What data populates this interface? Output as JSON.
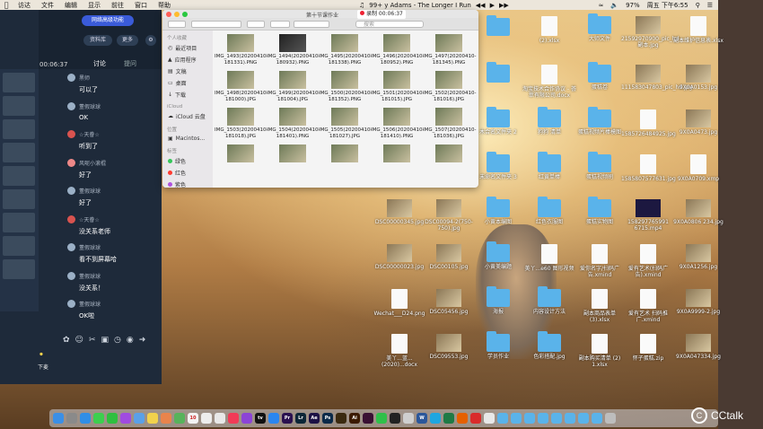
{
  "menubar": {
    "apple": "",
    "items": [
      "访达",
      "文件",
      "编辑",
      "显示",
      "前往",
      "窗口",
      "帮助"
    ],
    "now_playing": "99+ y Adams - The Longer I Run",
    "battery": "97%",
    "clock": "周五 下午6:55"
  },
  "recording": {
    "label": "录制 00:06:37"
  },
  "chat": {
    "promo": "网络高级功能",
    "buttons": {
      "materials": "资料库",
      "more": "更多"
    },
    "timer": "00:06:37",
    "tabs": [
      "讨论",
      "提问"
    ],
    "messages": [
      {
        "name": "黑师",
        "text": "可以了"
      },
      {
        "name": "董假球球",
        "text": "OK"
      },
      {
        "name": "☆天眷☆",
        "text": "听到了"
      },
      {
        "name": "风呢小滚棍",
        "text": "好了"
      },
      {
        "name": "董假球球",
        "text": "好了"
      },
      {
        "name": "☆天眷☆",
        "text": "没关系老师"
      },
      {
        "name": "董假球球",
        "text": "看不到屏幕哈"
      },
      {
        "name": "董假球球",
        "text": "没关系！"
      },
      {
        "name": "董假球球",
        "text": "OK啦"
      }
    ],
    "raise_hand": "下麦",
    "toolbar_icons": [
      "flower-icon",
      "emoji-icon",
      "scissors-icon",
      "image-icon",
      "clock-icon",
      "mic-icon",
      "send-icon"
    ]
  },
  "finder": {
    "title": "第十节课作业",
    "search_placeholder": "搜索",
    "sidebar": {
      "favorites_label": "个人收藏",
      "favorites": [
        "最近项目",
        "应用程序",
        "文稿",
        "桌面",
        "下载"
      ],
      "icloud_label": "iCloud",
      "icloud": [
        "iCloud 云盘"
      ],
      "locations_label": "位置",
      "locations": [
        "Macintos..."
      ],
      "tags_label": "标签",
      "tags": [
        {
          "name": "绿色",
          "color": "#34c759"
        },
        {
          "name": "红色",
          "color": "#ff3b30"
        },
        {
          "name": "紫色",
          "color": "#af52de"
        }
      ]
    },
    "files": [
      "IMG_1493(20200410-181331).PNG",
      "IMG_1494(20200410-180932).PNG",
      "IMG_1495(20200410-181338).PNG",
      "IMG_1496(20200410-180952).PNG",
      "IMG_1497(20200410-181345).PNG",
      "IMG_1498(20200410-181000).JPG",
      "IMG_1499(20200410-181004).JPG",
      "IMG_1500(20200410-181352).PNG",
      "IMG_1501(20200410-181015).JPG",
      "IMG_1502(20200410-181016).JPG",
      "IMG_1503(20200410-181018).JPG",
      "IMG_1504(20200410-181401).PNG",
      "IMG_1505(20200410-181027).JPG",
      "IMG_1506(20200410-181410).PNG",
      "IMG_1507(20200410-181036).JPG",
      "",
      "",
      "",
      "",
      ""
    ]
  },
  "desktop": {
    "col1": [
      "",
      "DSC00000345.jpg",
      "DSC00000023.jpg",
      "Wechat___D24.png",
      "美丫...蓝...(2020)...docx"
    ],
    "col1b": [
      "",
      "DSC00094-2(750-750).jpg",
      "DSC00105.jpg",
      "DSC05456.jpg",
      "DSC09553.jpg"
    ],
    "col2": [
      "",
      "",
      "木合名文件夹 2",
      "未命名文件夹 3",
      "小黄本编图",
      "小黄美编题",
      "",
      "海报",
      "学员作业"
    ],
    "col3": [
      "(2).xlsx",
      "淘宝技术合作协议 - 荟萃有限公司.docx",
      "狗狗 清单",
      "红黄单棒",
      "红色衣服图",
      "美丫...e60 图形视频",
      "内容设计方法",
      "色彩搭配.jpg"
    ],
    "col4": [
      "大师文件",
      "蛋糕卷",
      "蛋糕视频片棒模图",
      "蛋糕视频刷",
      "蛋糕实物图",
      "爱你名字/扫码广告.xmind",
      "副本商品表单 (3).xlsx",
      "副本购买清单 (2) 1.xlsx"
    ],
    "col5": [
      "21592970900_pic_hd副本.jpg",
      "111583047803_pic_hd.jpg",
      "1585726484925.jpg",
      "1585807577631.jpg",
      "158297765991 6715.mp4",
      "爱有艺术(扫码广告).xmind",
      "爱有艺术 扫码推广.xmind",
      "怀子蛋糕.zip"
    ],
    "col6": [
      "副本维护信息表.xlsx",
      "9X0A0153.jpg",
      "9X0A0473.jpg",
      "9X0A0709.xmp",
      "9X0A0806 234.jpg",
      "9X0A1256.jpg",
      "9X0A9999-2.jpg",
      "9X0A047334.jpg"
    ]
  },
  "dock": {
    "apps": [
      {
        "name": "finder-app",
        "color": "#3b8fe6",
        "label": ""
      },
      {
        "name": "launchpad-app",
        "color": "#8a8a8a",
        "label": ""
      },
      {
        "name": "safari-app",
        "color": "#2f8ee6",
        "label": ""
      },
      {
        "name": "messages-app",
        "color": "#3ccf4e",
        "label": ""
      },
      {
        "name": "facetime-app",
        "color": "#2fbf3f",
        "label": ""
      },
      {
        "name": "podcasts-app",
        "color": "#a04be0",
        "label": ""
      },
      {
        "name": "mail-app",
        "color": "#5aa0e8",
        "label": ""
      },
      {
        "name": "notes-app",
        "color": "#f2d24c",
        "label": ""
      },
      {
        "name": "photos-app",
        "color": "#e9844c",
        "label": ""
      },
      {
        "name": "maps-app",
        "color": "#57b35b",
        "label": ""
      },
      {
        "name": "calendar-app",
        "color": "#f3f3f3",
        "label": "10"
      },
      {
        "name": "reminders-app",
        "color": "#ededed",
        "label": ""
      },
      {
        "name": "notes2-app",
        "color": "#e8e8e8",
        "label": ""
      },
      {
        "name": "music-app",
        "color": "#f23b57",
        "label": ""
      },
      {
        "name": "podcast2-app",
        "color": "#8c44d6",
        "label": ""
      },
      {
        "name": "tv-app",
        "color": "#111",
        "label": "tv"
      },
      {
        "name": "appstore-app",
        "color": "#2a86f0",
        "label": ""
      },
      {
        "name": "premiere-app",
        "color": "#2b1150",
        "label": "Pr"
      },
      {
        "name": "lightroom-app",
        "color": "#0c2637",
        "label": "Lr"
      },
      {
        "name": "aftereffects-app",
        "color": "#1d1145",
        "label": "Ae"
      },
      {
        "name": "photoshop-app",
        "color": "#0b2a49",
        "label": "Ps"
      },
      {
        "name": "bridge-app",
        "color": "#3b2a10",
        "label": ""
      },
      {
        "name": "illustrator-app",
        "color": "#3b1a00",
        "label": "Ai"
      },
      {
        "name": "indesign-app",
        "color": "#3a1033",
        "label": ""
      },
      {
        "name": "wechat-app",
        "color": "#2fc04a",
        "label": ""
      },
      {
        "name": "qq-app",
        "color": "#222",
        "label": ""
      },
      {
        "name": "preview-app",
        "color": "#cfcfcf",
        "label": ""
      },
      {
        "name": "word-app",
        "color": "#2b579a",
        "label": "W"
      },
      {
        "name": "cctalk-app",
        "color": "#1ea6e0",
        "label": ""
      },
      {
        "name": "excel-app",
        "color": "#1f7a45",
        "label": ""
      },
      {
        "name": "firefox-app",
        "color": "#e66000",
        "label": ""
      },
      {
        "name": "netease-app",
        "color": "#d92b2b",
        "label": ""
      },
      {
        "name": "chrome-app",
        "color": "#e8e8e8",
        "label": ""
      },
      {
        "name": "folder1-app",
        "color": "#5ab3ea",
        "label": ""
      },
      {
        "name": "folder2-app",
        "color": "#5ab3ea",
        "label": ""
      },
      {
        "name": "folder3-app",
        "color": "#5ab3ea",
        "label": ""
      },
      {
        "name": "folder4-app",
        "color": "#5ab3ea",
        "label": ""
      },
      {
        "name": "folder5-app",
        "color": "#5ab3ea",
        "label": ""
      },
      {
        "name": "folder6-app",
        "color": "#5ab3ea",
        "label": ""
      },
      {
        "name": "folder7-app",
        "color": "#5ab3ea",
        "label": ""
      },
      {
        "name": "folder8-app",
        "color": "#5ab3ea",
        "label": ""
      },
      {
        "name": "trash-app",
        "color": "#bdbdbd",
        "label": ""
      }
    ]
  },
  "watermark": {
    "text": "CCtalk"
  }
}
